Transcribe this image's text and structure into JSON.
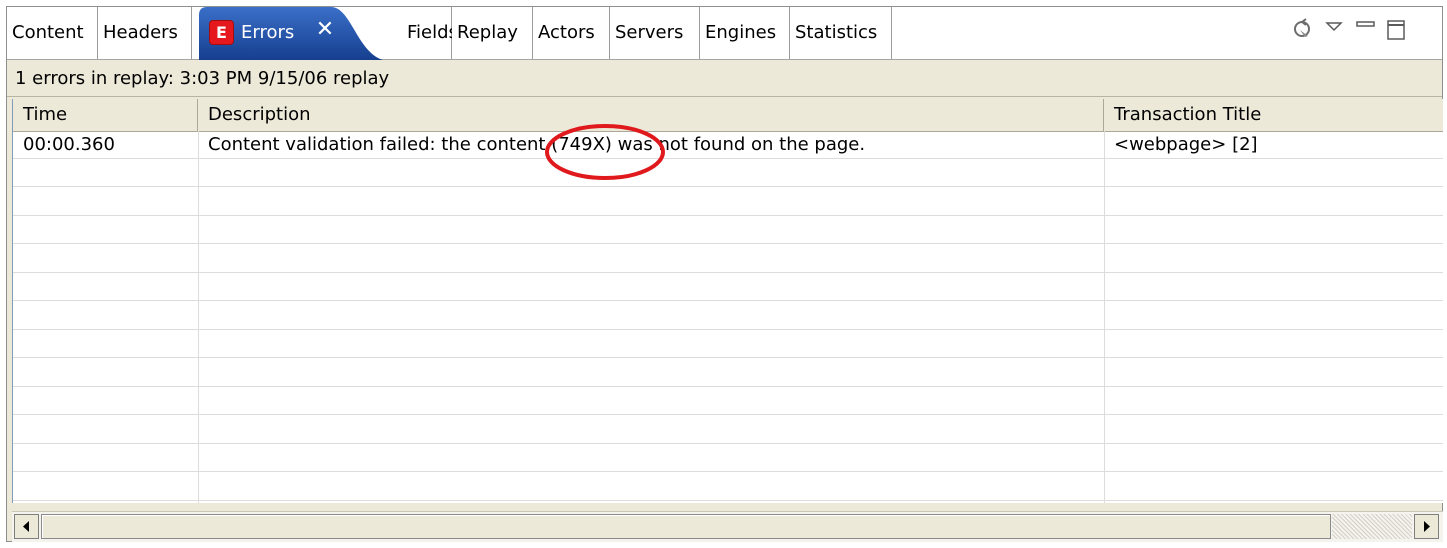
{
  "tabs": [
    {
      "label": "Content"
    },
    {
      "label": "Headers"
    },
    {
      "label": "Errors",
      "badge": "E",
      "active": true
    },
    {
      "label": "Fields"
    },
    {
      "label": "Replay"
    },
    {
      "label": "Actors"
    },
    {
      "label": "Servers"
    },
    {
      "label": "Engines"
    },
    {
      "label": "Statistics"
    }
  ],
  "active_tab_close": "✕",
  "view_toolbar": {
    "icons": [
      "refresh-icon",
      "view-menu-icon",
      "minimize-icon",
      "maximize-icon"
    ]
  },
  "status": "1 errors in replay: 3:03 PM 9/15/06 replay",
  "table": {
    "columns": [
      "Time",
      "Description",
      "Transaction Title"
    ],
    "rows": [
      [
        "00:00.360",
        "Content validation failed: the content (749X) was not found on the page.",
        "<webpage> [2]"
      ]
    ]
  },
  "annotation": {
    "color": "#e0191d"
  },
  "colors": {
    "active_tab": "#1c4fa5",
    "error_badge": "#e5181d",
    "panel_bg": "#ece9d8"
  }
}
